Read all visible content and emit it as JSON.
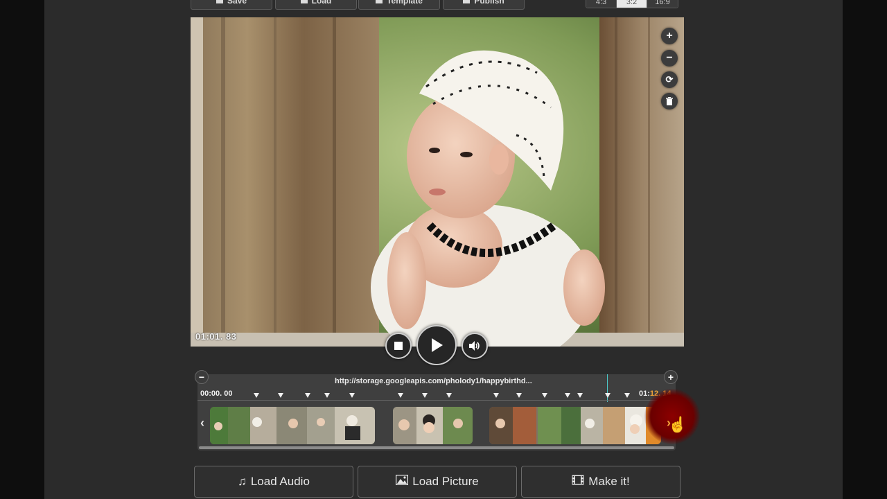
{
  "toolbar": {
    "save_label": "Save",
    "load_label": "Load",
    "template_label": "Template",
    "publish_label": "Publish"
  },
  "ratios": {
    "r1": "4:3",
    "r2": "3:2",
    "r3": "16:9",
    "active": "3:2"
  },
  "preview": {
    "timecode": "01:01. 83"
  },
  "controls": {
    "stop_icon": "stop-icon",
    "play_icon": "play-icon",
    "volume_icon": "volume-icon"
  },
  "side_tools": [
    "zoom-in-icon",
    "zoom-out-icon",
    "rotate-icon",
    "trash-icon"
  ],
  "timeline": {
    "source_url": "http://storage.googleapis.com/pholody1/happybirthd...",
    "start_time": "00:00. 00",
    "end_time_prefix": "01:",
    "end_time_highlight": "12. 14",
    "zoom_out": "−",
    "zoom_in": "+"
  },
  "actions": {
    "load_audio": "Load Audio",
    "load_picture": "Load Picture",
    "make_it": "Make it!"
  },
  "colors": {
    "background": "#2b2b2b",
    "accent_orange": "#f0a23a",
    "playhead_teal": "#4dc9c9",
    "cursor_highlight": "#8c0000"
  }
}
